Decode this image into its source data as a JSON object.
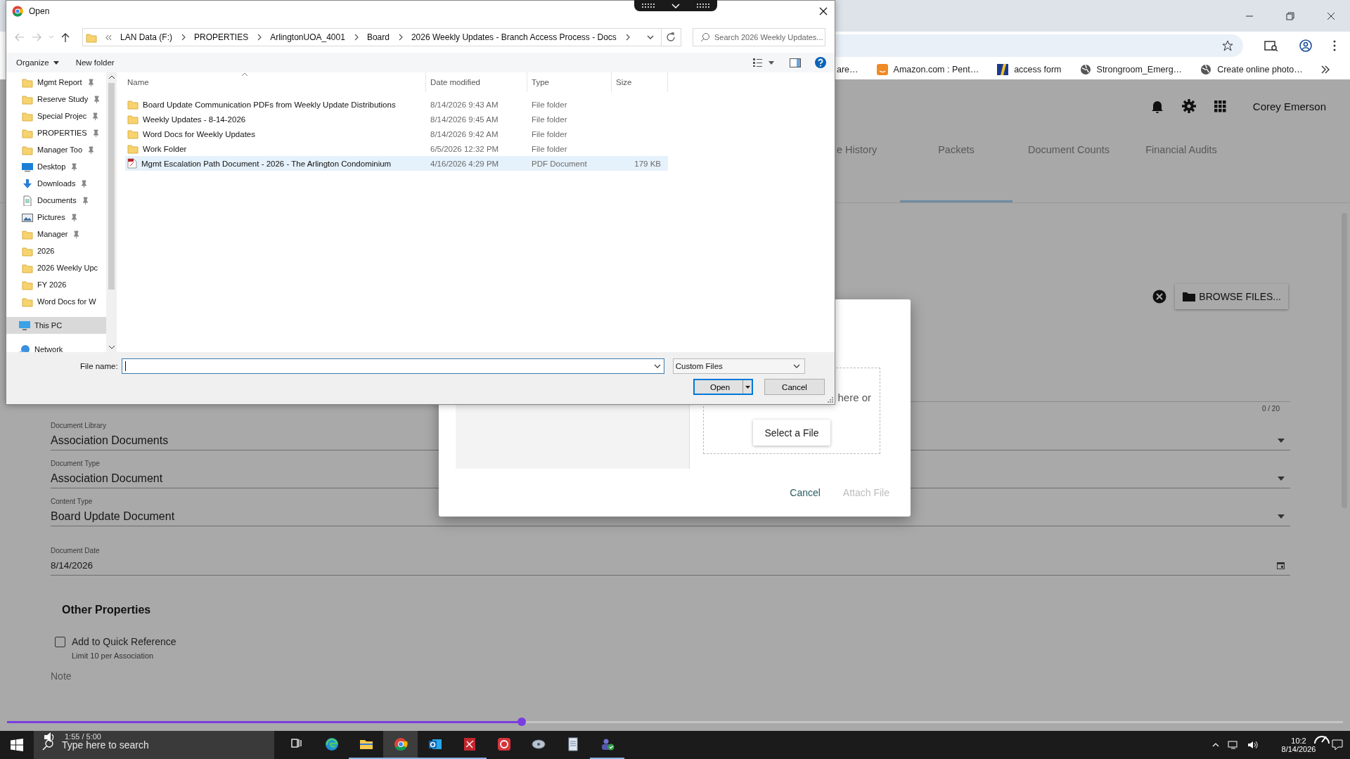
{
  "browser": {
    "bookmarks": [
      {
        "label": "are…",
        "kind": "plain"
      },
      {
        "label": "Amazon.com : Pent…",
        "kind": "amazon"
      },
      {
        "label": "access form",
        "kind": "flag"
      },
      {
        "label": "Strongroom_Emerg…",
        "kind": "globe"
      },
      {
        "label": "Create online photo…",
        "kind": "globe"
      }
    ]
  },
  "app": {
    "user": "Corey Emerson",
    "tabs": [
      {
        "label": "e History",
        "selected": false
      },
      {
        "label": "Packets",
        "selected": true
      },
      {
        "label": "Document Counts",
        "selected": false
      },
      {
        "label": "Financial Audits",
        "selected": false
      }
    ],
    "browse_button": "BROWSE FILES...",
    "counter": "0 / 20",
    "fields": [
      {
        "label": "Document Library",
        "value": "Association Documents",
        "kind": "select"
      },
      {
        "label": "Document Type",
        "value": "Association Document",
        "kind": "select"
      },
      {
        "label": "Content Type",
        "value": "Board Update Document",
        "kind": "select"
      },
      {
        "label": "Document Date",
        "value": "8/14/2026",
        "kind": "date"
      }
    ],
    "section_title": "Other Properties",
    "quick_reference": {
      "label": "Add to Quick Reference",
      "checked": false,
      "hint": "Limit 10 per Association"
    },
    "note_label": "Note"
  },
  "attach_modal": {
    "drop_text": "here or",
    "select_button": "Select a File",
    "buttons": [
      {
        "label": "Cancel",
        "disabled": false
      },
      {
        "label": "Attach File",
        "disabled": true
      }
    ]
  },
  "open_dialog": {
    "title": "Open",
    "path": [
      "LAN Data (F:)",
      "PROPERTIES",
      "ArlingtonUOA_4001",
      "Board",
      "2026 Weekly Updates - Branch Access Process - Docs"
    ],
    "search_placeholder": "Search 2026 Weekly Updates...",
    "toolbar": [
      "Organize",
      "New folder"
    ],
    "nav": [
      {
        "label": "Mgmt Report",
        "kind": "folder",
        "pinned": true,
        "selected": false
      },
      {
        "label": "Reserve Study",
        "kind": "folder",
        "pinned": true,
        "selected": false
      },
      {
        "label": "Special Projec",
        "kind": "folder",
        "pinned": true,
        "selected": false
      },
      {
        "label": "PROPERTIES",
        "kind": "folder",
        "pinned": true,
        "selected": false
      },
      {
        "label": "Manager Too",
        "kind": "folder",
        "pinned": true,
        "selected": false
      },
      {
        "label": "Desktop",
        "kind": "desktop",
        "pinned": true,
        "selected": false
      },
      {
        "label": "Downloads",
        "kind": "downloads",
        "pinned": true,
        "selected": false
      },
      {
        "label": "Documents",
        "kind": "documents",
        "pinned": true,
        "selected": false
      },
      {
        "label": "Pictures",
        "kind": "pictures",
        "pinned": true,
        "selected": false
      },
      {
        "label": "Manager",
        "kind": "folder",
        "pinned": true,
        "selected": false
      },
      {
        "label": "2026",
        "kind": "folder",
        "pinned": false,
        "selected": false
      },
      {
        "label": "2026 Weekly Upc",
        "kind": "folder",
        "pinned": false,
        "selected": false
      },
      {
        "label": "FY 2026",
        "kind": "folder",
        "pinned": false,
        "selected": false
      },
      {
        "label": "Word Docs for W",
        "kind": "folder",
        "pinned": false,
        "selected": false
      },
      {
        "label": "This PC",
        "kind": "pc",
        "pinned": false,
        "selected": true
      },
      {
        "label": "Network",
        "kind": "network",
        "pinned": false,
        "selected": false
      }
    ],
    "columns": [
      "Name",
      "Date modified",
      "Type",
      "Size"
    ],
    "files": [
      {
        "name": "Board Update Communication PDFs from Weekly Update Distributions",
        "date": "8/14/2026 9:43 AM",
        "type": "File folder",
        "kind": "folder",
        "selected": false
      },
      {
        "name": "Weekly Updates - 8-14-2026",
        "date": "8/14/2026 9:45 AM",
        "type": "File folder",
        "kind": "folder",
        "selected": false
      },
      {
        "name": "Word Docs for Weekly Updates",
        "date": "8/14/2026 9:42 AM",
        "type": "File folder",
        "kind": "folder",
        "selected": false
      },
      {
        "name": "Work Folder",
        "date": "6/5/2026 12:32 PM",
        "type": "File folder",
        "kind": "folder",
        "selected": false
      },
      {
        "name": "Mgmt Escalation Path Document - 2026 - The Arlington Condominium",
        "date": "4/16/2026 4:29 PM",
        "type": "PDF Document",
        "size": "179 KB",
        "kind": "pdf",
        "selected": true
      }
    ],
    "file_name_label": "File name:",
    "file_type": "Custom Files",
    "buttons": [
      "Open",
      "Cancel"
    ]
  },
  "video_player": {
    "time": "1:55 / 5:00",
    "level": 0.385
  },
  "taskbar": {
    "search_placeholder": "Type here to search",
    "time": "10:2",
    "date": "8/14/2026",
    "apps": [
      {
        "kind": "taskview",
        "open": false,
        "selected": false
      },
      {
        "kind": "edge",
        "open": false,
        "selected": false
      },
      {
        "kind": "explorer",
        "open": true,
        "selected": false
      },
      {
        "kind": "chrome",
        "open": true,
        "selected": true
      },
      {
        "kind": "outlook",
        "open": true,
        "selected": false
      },
      {
        "kind": "pdf",
        "open": true,
        "selected": false
      },
      {
        "kind": "redcircle",
        "open": false,
        "selected": false
      },
      {
        "kind": "disc",
        "open": false,
        "selected": false
      },
      {
        "kind": "notepad",
        "open": false,
        "selected": false
      },
      {
        "kind": "teams",
        "open": true,
        "selected": false
      }
    ]
  }
}
